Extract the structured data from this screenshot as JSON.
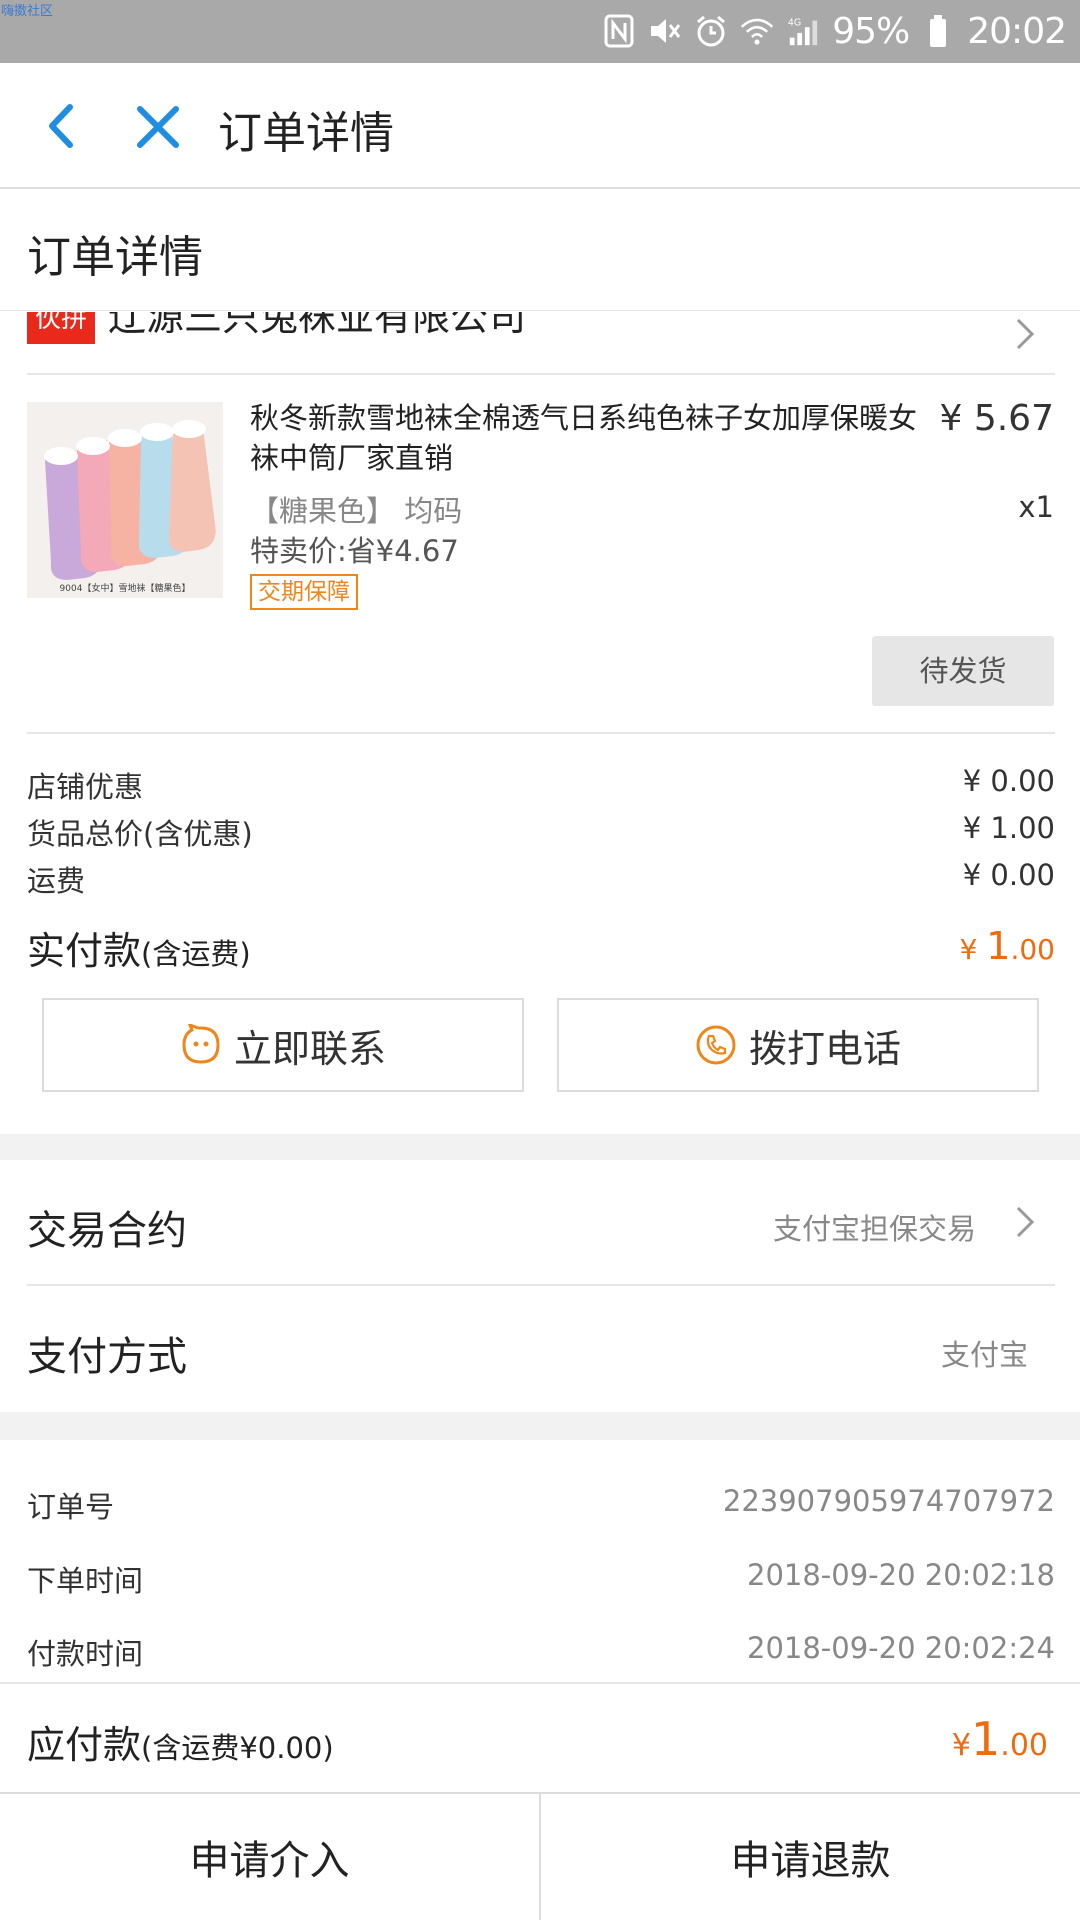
{
  "status_bar": {
    "corner_text": "嗨擞社区",
    "battery": "95%",
    "time": "20:02"
  },
  "nav": {
    "title": "订单详情"
  },
  "section": {
    "title": "订单详情"
  },
  "shop": {
    "badge": "伙拼",
    "name": "辽源三只兔袜业有限公司"
  },
  "product": {
    "title": "秋冬新款雪地袜全棉透气日系纯色袜子女加厚保暖女袜中筒厂家直销",
    "price": "¥ 5.67",
    "sku": "【糖果色】 均码",
    "qty": "x1",
    "sale": "特卖价:省¥4.67",
    "guarantee": "交期保障",
    "image_caption": "9004【女中】雪地袜【糖果色】",
    "status": "待发货"
  },
  "prices": {
    "shop_discount_label": "店铺优惠",
    "shop_discount_value": "¥ 0.00",
    "goods_total_label": "货品总价(含优惠)",
    "goods_total_value": "¥ 1.00",
    "shipping_label": "运费",
    "shipping_value": "¥ 0.00",
    "paid_label": "实付款",
    "paid_note": "(含运费)",
    "paid_currency": "¥ ",
    "paid_int": "1",
    "paid_dec": ".00"
  },
  "actions": {
    "contact": "立即联系",
    "call": "拨打电话"
  },
  "contract": {
    "label": "交易合约",
    "value": "支付宝担保交易"
  },
  "payment": {
    "label": "支付方式",
    "value": "支付宝"
  },
  "order_meta": {
    "order_no_label": "订单号",
    "order_no": "223907905974707972",
    "order_time_label": "下单时间",
    "order_time": "2018-09-20 20:02:18",
    "pay_time_label": "付款时间",
    "pay_time": "2018-09-20 20:02:24"
  },
  "payable": {
    "label": "应付款",
    "note": "(含运费¥0.00)",
    "currency": "¥",
    "int": "1",
    "dec": ".00"
  },
  "bottom": {
    "intervene": "申请介入",
    "refund": "申请退款"
  },
  "colors": {
    "accent_orange": "#f06a0f",
    "nav_blue": "#1f8de0",
    "badge_red": "#e8291c"
  }
}
